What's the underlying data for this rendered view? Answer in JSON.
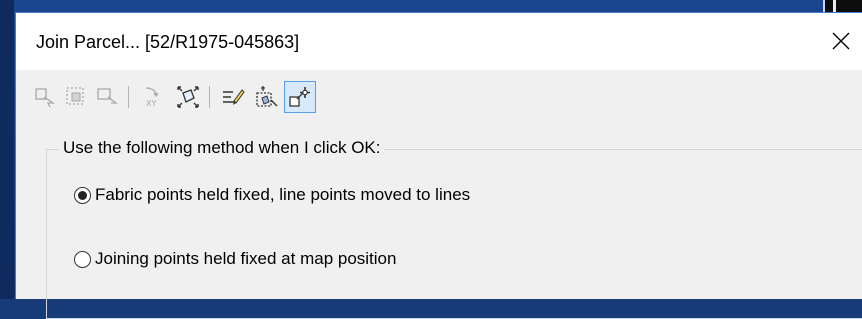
{
  "dialog": {
    "title": "Join Parcel... [52/R1975-045863]"
  },
  "toolbar": {
    "buttons": [
      {
        "icon": "parcel-select-icon",
        "enabled": false
      },
      {
        "icon": "parcel-frame-icon",
        "enabled": false
      },
      {
        "icon": "parcel-select-alt-icon",
        "enabled": false
      },
      {
        "icon": "xy-coordinates-icon",
        "enabled": false
      },
      {
        "icon": "zoom-to-parcel-icon",
        "enabled": true
      },
      {
        "icon": "edit-lines-icon",
        "enabled": true
      },
      {
        "icon": "parcel-properties-icon",
        "enabled": true
      },
      {
        "icon": "pan-to-parcel-icon",
        "enabled": true,
        "active": true
      }
    ]
  },
  "method_group": {
    "legend": "Use the following method when I click OK:",
    "options": [
      {
        "label": "Fabric points held fixed, line points moved to lines",
        "selected": true
      },
      {
        "label": "Joining points held fixed at map position",
        "selected": false
      }
    ]
  },
  "colors": {
    "accent": "#3d7cc9",
    "desktop": "#173a78",
    "dialog_bg": "#f0f0f0",
    "titlebar_bg": "#ffffff"
  }
}
